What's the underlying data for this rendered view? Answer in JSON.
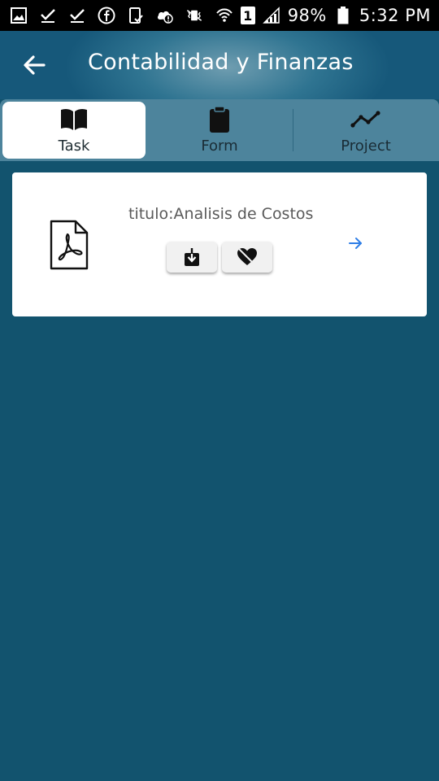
{
  "status_bar": {
    "battery": "98%",
    "time": "5:32 PM",
    "sim_slot": "1",
    "icons": [
      "gallery-icon",
      "check-icon",
      "check-icon",
      "facebook-icon",
      "phone-check-icon",
      "cloud-icon",
      "vibrate-icon",
      "wifi-icon",
      "sim-icon",
      "signal-icon",
      "battery-icon"
    ]
  },
  "header": {
    "title": "Contabilidad y Finanzas",
    "back_icon": "arrow-left-icon"
  },
  "tabs": [
    {
      "label": "Task",
      "icon": "book-icon",
      "active": true
    },
    {
      "label": "Form",
      "icon": "clipboard-icon",
      "active": false
    },
    {
      "label": "Project",
      "icon": "trend-line-icon",
      "active": false
    }
  ],
  "card": {
    "title": "titulo:Analisis de Costos",
    "file_icon": "pdf-file-icon",
    "actions": [
      "download-icon",
      "heart-off-icon"
    ],
    "open_icon": "arrow-right-icon"
  },
  "colors": {
    "background": "#12536e",
    "header": "#2f7491",
    "tab_bar": "#4d849c",
    "accent_arrow": "#2f7ee6"
  }
}
